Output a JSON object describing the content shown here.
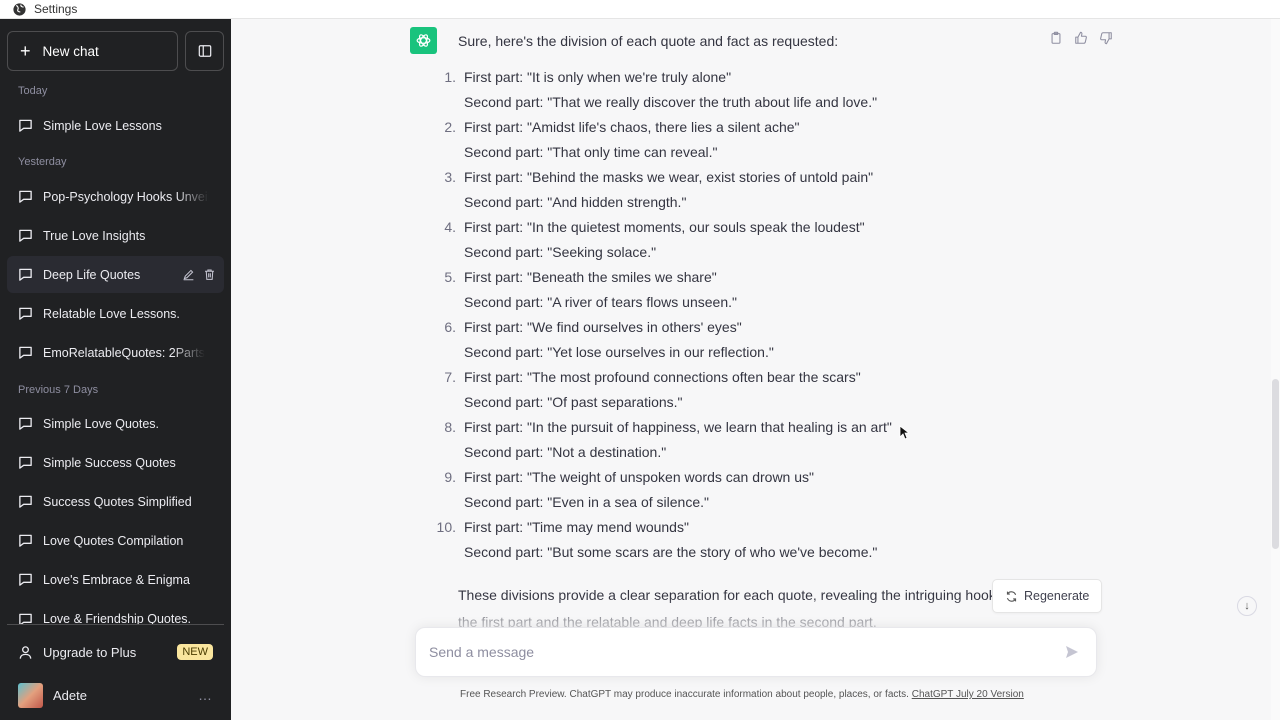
{
  "window": {
    "title": "Settings"
  },
  "sidebar": {
    "new_chat_label": "New chat",
    "groups": [
      {
        "label": "Today",
        "items": [
          {
            "label": "Simple Love Lessons"
          }
        ]
      },
      {
        "label": "Yesterday",
        "items": [
          {
            "label": "Pop-Psychology Hooks Unveiled"
          },
          {
            "label": "True Love Insights"
          },
          {
            "label": "Deep Life Quotes",
            "active": true
          },
          {
            "label": "Relatable Love Lessons."
          },
          {
            "label": "EmoRelatableQuotes: 2Parts"
          }
        ]
      },
      {
        "label": "Previous 7 Days",
        "items": [
          {
            "label": "Simple Love Quotes."
          },
          {
            "label": "Simple Success Quotes"
          },
          {
            "label": "Success Quotes Simplified"
          },
          {
            "label": "Love Quotes Compilation"
          },
          {
            "label": "Love's Embrace & Enigma"
          },
          {
            "label": "Love & Friendship Quotes."
          }
        ]
      }
    ],
    "upgrade_label": "Upgrade to Plus",
    "upgrade_badge": "NEW",
    "user_name": "Adete",
    "more_label": "…"
  },
  "chat": {
    "intro": "Sure, here's the division of each quote and fact as requested:",
    "quotes": [
      {
        "num": "1.",
        "first": "First part: \"It is only when we're truly alone\"",
        "second": "Second part: \"That we really discover the truth about life and love.\""
      },
      {
        "num": "2.",
        "first": "First part: \"Amidst life's chaos, there lies a silent ache\"",
        "second": "Second part: \"That only time can reveal.\""
      },
      {
        "num": "3.",
        "first": "First part: \"Behind the masks we wear, exist stories of untold pain\"",
        "second": "Second part: \"And hidden strength.\""
      },
      {
        "num": "4.",
        "first": "First part: \"In the quietest moments, our souls speak the loudest\"",
        "second": "Second part: \"Seeking solace.\""
      },
      {
        "num": "5.",
        "first": "First part: \"Beneath the smiles we share\"",
        "second": "Second part: \"A river of tears flows unseen.\""
      },
      {
        "num": "6.",
        "first": "First part: \"We find ourselves in others' eyes\"",
        "second": "Second part: \"Yet lose ourselves in our reflection.\""
      },
      {
        "num": "7.",
        "first": "First part: \"The most profound connections often bear the scars\"",
        "second": "Second part: \"Of past separations.\""
      },
      {
        "num": "8.",
        "first": "First part: \"In the pursuit of happiness, we learn that healing is an art\"",
        "second": "Second part: \"Not a destination.\""
      },
      {
        "num": "9.",
        "first": "First part: \"The weight of unspoken words can drown us\"",
        "second": "Second part: \"Even in a sea of silence.\""
      },
      {
        "num": "10.",
        "first": "First part: \"Time may mend wounds\"",
        "second": "Second part: \"But some scars are the story of who we've become.\""
      }
    ],
    "closing_line1": "These divisions provide a clear separation for each quote, revealing the intriguing hooks in",
    "closing_line2": "the first part and the relatable and deep life facts in the second part.",
    "regenerate_label": "Regenerate"
  },
  "composer": {
    "placeholder": "Send a message",
    "value": ""
  },
  "footer": {
    "note": "Free Research Preview. ChatGPT may produce inaccurate information about people, places, or facts. ",
    "version_link": "ChatGPT July 20 Version"
  },
  "colors": {
    "sidebar_bg": "#202123",
    "main_bg": "#f7f7f8",
    "accent_green": "#19c37d",
    "badge_yellow": "#fae69e"
  }
}
